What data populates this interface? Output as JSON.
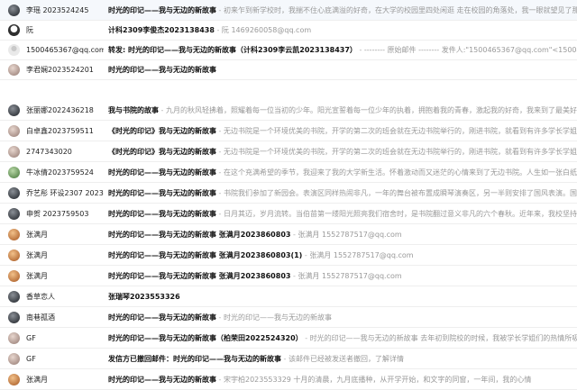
{
  "colors": {
    "subject": "#111111",
    "preview": "#999999",
    "divider": "#eeeeee"
  },
  "rows": [
    {
      "sender": "李瑶 2023524245",
      "subject": "时光的印记——我与无边的新故事",
      "sep": " - ",
      "preview": "初来乍到新学校时，我揣不住心底满溢的好奇，在大学的校园里四处闲逛 走在校园的角落处，我一眼就望见了那不一样的风景",
      "avatar": "avatar-photo-dark"
    },
    {
      "sender": "阮",
      "subject": "计科2309李俊杰2023138438",
      "sep": " - ",
      "preview": "阮 1469260058@qq.com",
      "avatar": "avatar-cartoon"
    },
    {
      "sender": "1500465367@qq.com",
      "subject": "转发: 时光的印记——我与无边的新故事（计科2309李云凯2023138437）",
      "sep": " - ",
      "preview": "-------- 原始邮件 -------- 发件人:\"1500465367@qq.com\"<1500465367@qq.com>",
      "avatar": "avatar-default"
    },
    {
      "sender": "李君娴2023524201",
      "subject": "时光的印记——我与无边的新故事",
      "sep": "",
      "preview": "",
      "avatar": "avatar-photo-light"
    },
    {
      "sender": "张丽娜2022436218",
      "subject": "我与书院的故事",
      "sep": " - ",
      "preview": "九月的秋风轻拂着，照耀着每一位当初的少年。阳光宣誓着每一位少年的执着，拥抱着我的青春，激起我的好奇，我来到了最美好的样子",
      "avatar": "avatar-photo-dark"
    },
    {
      "sender": "白卓鑫2023759511",
      "subject": "《时光的印记》我与无边的新故事",
      "sep": " - ",
      "preview": "无边书院是一个环境优美的书院，开学的第二次的班会就在无边书院举行的，刚进书院，就看到有许多学长学姐在学习工作",
      "avatar": "avatar-photo-light"
    },
    {
      "sender": "2747343020",
      "subject": "《时光的印记》我与无边的新故事",
      "sep": " - ",
      "preview": "无边书院是一个环境优美的书院，开学的第二次的班会就在无边书院举行的，刚进书院，就看到有许多学长学姐在学习工作",
      "avatar": "avatar-photo-light"
    },
    {
      "sender": "牛冰倩2023759524",
      "subject": "时光的印记——我与无边的新故事",
      "sep": " - ",
      "preview": "在这个充满希望的季节，我迎来了我的大学新生活。怀着激动而又迷茫的心情来到了无边书院。人生如一张白纸，在成长的过程中",
      "avatar": "avatar-photo-green"
    },
    {
      "sender": "乔艺彤 环设2307 2023…",
      "subject": "时光的印记——我与无边的新故事",
      "sep": " - ",
      "preview": "书院我们参加了新园会。表演区同样热闹非凡，一年的舞台被布置成瞬琴演奏区，另一半则安排了国风表演。国风乐器琵琶、古筝",
      "avatar": "avatar-photo-dark"
    },
    {
      "sender": "申贺 2023759503",
      "subject": "时光的印记——我与无边的新故事",
      "sep": " - ",
      "preview": "日月其迈，岁月流转。当伯苗第一缕阳光照亮我们宿舍时，是书院翻过意义非凡的六个春秋。近年来，我校坚持把推进书院制育人改革",
      "avatar": "avatar-photo-dark"
    },
    {
      "sender": "张满月",
      "subject": "时光的印记——我与无边的新故事 张满月2023860803",
      "sep": " - ",
      "preview": "张满月 1552787517@qq.com",
      "avatar": "avatar-photo-orange"
    },
    {
      "sender": "张满月",
      "subject": "时光的印记——我与无边的新故事 张满月2023860803(1)",
      "sep": " - ",
      "preview": "张满月 1552787517@qq.com",
      "avatar": "avatar-photo-orange"
    },
    {
      "sender": "张满月",
      "subject": "时光的印记——我与无边的新故事 张满月2023860803",
      "sep": " - ",
      "preview": "张满月 1552787517@qq.com",
      "avatar": "avatar-photo-orange"
    },
    {
      "sender": "香草恋人",
      "subject": "张瑞琴2023553326",
      "sep": "",
      "preview": "",
      "avatar": "avatar-photo-dark"
    },
    {
      "sender": "南巷孤酒",
      "subject": "时光的印记——我与无边的新故事",
      "sep": " - ",
      "preview": "时光的印记——我与无边的新故事",
      "avatar": "avatar-photo-dark"
    },
    {
      "sender": "GF",
      "subject": "时光的印记——我与无边的新故事（柏荣田2022524320）",
      "sep": " - ",
      "preview": "时光的印记——我与无边的新故事 去年初到院校的时候，我被学长学姐们的热情所吸引到了，从而加入无边",
      "avatar": "avatar-photo-light"
    },
    {
      "sender": "GF",
      "subject": "发信方已撤回邮件：时光的印记——我与无边的新故事",
      "sep": " - ",
      "preview": "该邮件已经被发送者撤回，了解详情",
      "avatar": "avatar-photo-light"
    },
    {
      "sender": "张满月",
      "subject": "时光的印记——我与无边的新故事",
      "sep": " - ",
      "preview": "宋宇柏2023553329 十月的清晨，九月底播种，从开学开始，和文字的同窗，一年间，我的心情",
      "avatar": "avatar-photo-orange"
    }
  ]
}
